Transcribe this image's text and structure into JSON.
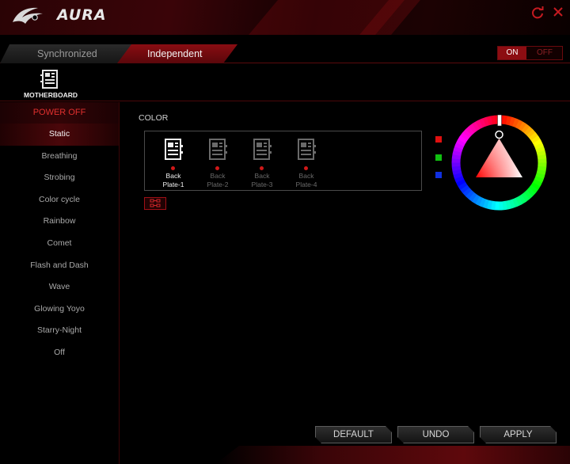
{
  "app": {
    "title": "AURA"
  },
  "tabs": {
    "synchronized": "Synchronized",
    "independent": "Independent"
  },
  "toggle": {
    "on": "ON",
    "off": "OFF",
    "state": "ON"
  },
  "device": {
    "label": "MOTHERBOARD",
    "icon": "motherboard-icon"
  },
  "sidebar": {
    "power_off": "POWER OFF",
    "modes": [
      "Static",
      "Breathing",
      "Strobing",
      "Color cycle",
      "Rainbow",
      "Comet",
      "Flash and Dash",
      "Wave",
      "Glowing Yoyo",
      "Starry-Night",
      "Off"
    ],
    "selected": "Static"
  },
  "color_section": {
    "label": "COLOR",
    "plates": [
      {
        "name": "Back\nPlate-1",
        "selected": true
      },
      {
        "name": "Back\nPlate-2",
        "selected": false
      },
      {
        "name": "Back\nPlate-3",
        "selected": false
      },
      {
        "name": "Back\nPlate-4",
        "selected": false
      }
    ],
    "swatches": [
      "#e01010",
      "#10c010",
      "#1030e0"
    ]
  },
  "buttons": {
    "default": "DEFAULT",
    "undo": "UNDO",
    "apply": "APPLY"
  },
  "colors": {
    "accent": "#8c0d12",
    "power_off_text": "#e0302e",
    "led_dot": "#d01818"
  }
}
